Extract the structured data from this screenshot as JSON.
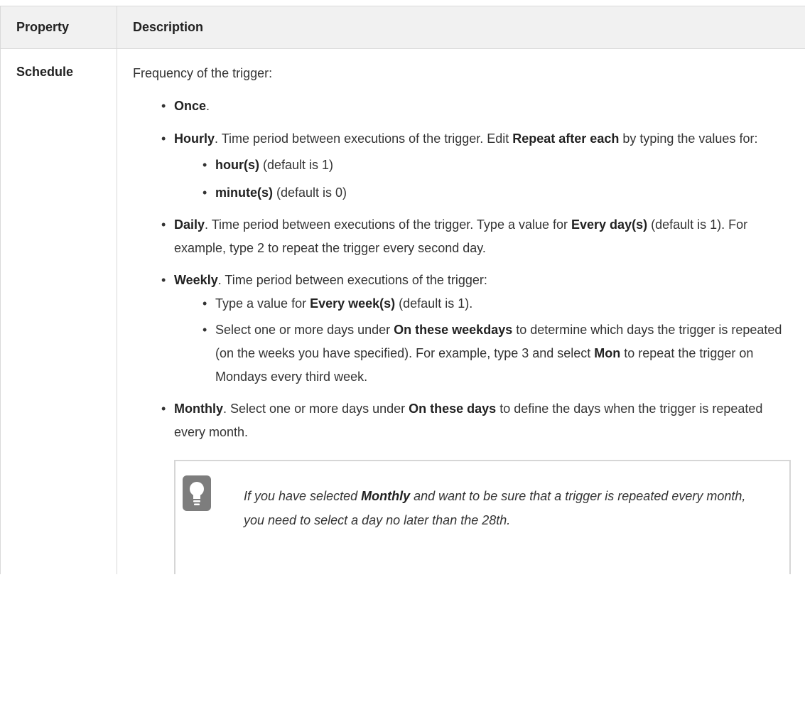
{
  "header": {
    "property": "Property",
    "description": "Description"
  },
  "row": {
    "property": "Schedule",
    "intro": "Frequency of the trigger:",
    "once": {
      "term": "Once",
      "rest": "."
    },
    "hourly": {
      "term": "Hourly",
      "text1": ". Time period between executions of the trigger. Edit ",
      "term2": "Repeat after each",
      "text2": " by typing the values for:",
      "sub": [
        {
          "term": "hour(s)",
          "rest": " (default is 1)"
        },
        {
          "term": "minute(s)",
          "rest": " (default is 0)"
        }
      ]
    },
    "daily": {
      "term": "Daily",
      "text1": ". Time period between executions of the trigger. Type a value for ",
      "term2": "Every day(s)",
      "text2": " (default is 1). For example, type 2 to repeat the trigger every second day."
    },
    "weekly": {
      "term": "Weekly",
      "text1": ". Time period between executions of the trigger:",
      "sub1": {
        "pre": "Type a value for ",
        "term": "Every week(s)",
        "rest": " (default is 1)."
      },
      "sub2": {
        "pre": "Select one or more days under ",
        "term": "On these weekdays",
        "mid": " to determine which days the trigger is repeated (on the weeks you have specified). For example, type 3 and select ",
        "term2": "Mon",
        "rest": " to repeat the trigger on Mondays every third week."
      }
    },
    "monthly": {
      "term": "Monthly",
      "text1": ". Select one or more days under ",
      "term2": "On these days",
      "text2": " to define the days when the trigger is repeated every month."
    },
    "note": {
      "icon": "lightbulb-icon",
      "pre": "If you have selected ",
      "term": "Monthly",
      "rest": " and want to be sure that a trigger is repeated every month, you need to select a day no later than the 28th."
    }
  }
}
